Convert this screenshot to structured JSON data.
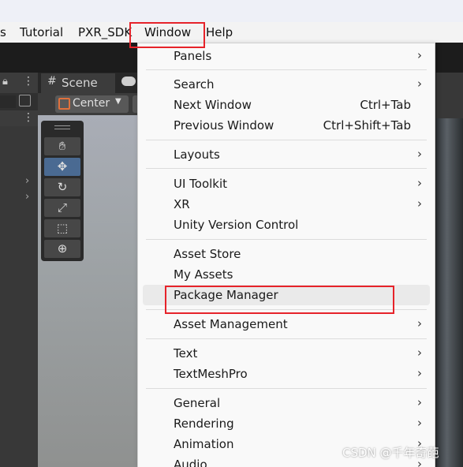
{
  "menubar": {
    "items": [
      "s",
      "Tutorial",
      "PXR_SDK",
      "Window",
      "Help"
    ]
  },
  "scene": {
    "tab_label": "Scene",
    "center_label": "Center"
  },
  "window_menu": {
    "groups": [
      [
        {
          "label": "Panels",
          "submenu": true
        }
      ],
      [
        {
          "label": "Search",
          "submenu": true
        },
        {
          "label": "Next Window",
          "shortcut": "Ctrl+Tab"
        },
        {
          "label": "Previous Window",
          "shortcut": "Ctrl+Shift+Tab"
        }
      ],
      [
        {
          "label": "Layouts",
          "submenu": true
        }
      ],
      [
        {
          "label": "UI Toolkit",
          "submenu": true
        },
        {
          "label": "XR",
          "submenu": true
        },
        {
          "label": "Unity Version Control"
        }
      ],
      [
        {
          "label": "Asset Store"
        },
        {
          "label": "My Assets"
        },
        {
          "label": "Package Manager",
          "highlighted": true
        }
      ],
      [
        {
          "label": "Asset Management",
          "submenu": true
        }
      ],
      [
        {
          "label": "Text",
          "submenu": true
        },
        {
          "label": "TextMeshPro",
          "submenu": true
        }
      ],
      [
        {
          "label": "General",
          "submenu": true
        },
        {
          "label": "Rendering",
          "submenu": true
        },
        {
          "label": "Animation",
          "submenu": true
        },
        {
          "label": "Audio",
          "submenu": true
        }
      ]
    ]
  },
  "watermark": "CSDN @千年奇葩",
  "colors": {
    "highlight_box": "#e6232a",
    "menu_bg": "#f9f9f9",
    "tool_active": "#4a6a92"
  },
  "icons": {
    "submenu_arrow": "›",
    "hand_tool": "hand-icon",
    "move_tool": "move-icon",
    "rotate_tool": "rotate-icon",
    "scale_tool": "scale-icon",
    "rect_tool": "rect-icon",
    "transform_tool": "transform-icon"
  }
}
